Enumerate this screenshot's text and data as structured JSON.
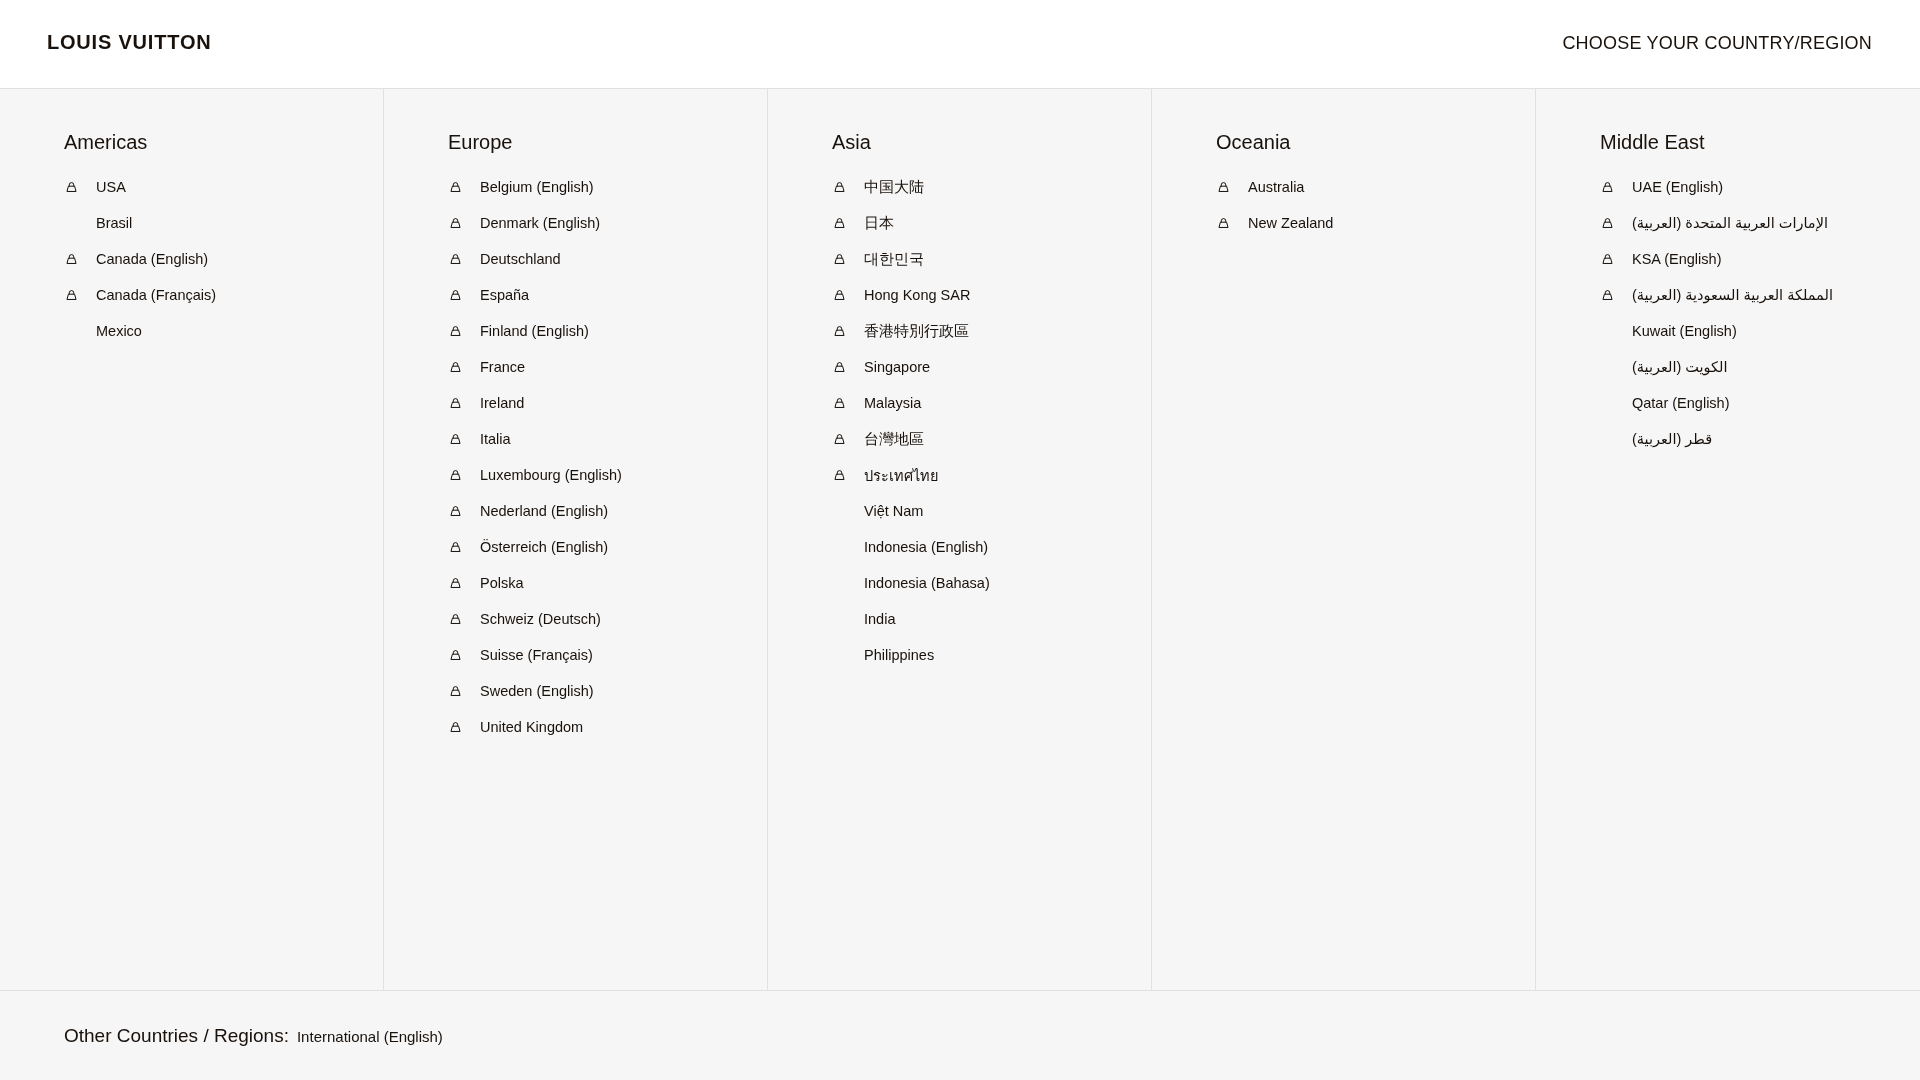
{
  "header": {
    "logo": "LOUIS VUITTON",
    "title": "CHOOSE YOUR COUNTRY/REGION"
  },
  "regions": [
    {
      "name": "Americas",
      "countries": [
        {
          "label": "USA",
          "shopping": true
        },
        {
          "label": "Brasil",
          "shopping": false
        },
        {
          "label": "Canada (English)",
          "shopping": true
        },
        {
          "label": "Canada (Français)",
          "shopping": true
        },
        {
          "label": "Mexico",
          "shopping": false
        }
      ]
    },
    {
      "name": "Europe",
      "countries": [
        {
          "label": "Belgium (English)",
          "shopping": true
        },
        {
          "label": "Denmark (English)",
          "shopping": true
        },
        {
          "label": "Deutschland",
          "shopping": true
        },
        {
          "label": "España",
          "shopping": true
        },
        {
          "label": "Finland (English)",
          "shopping": true
        },
        {
          "label": "France",
          "shopping": true
        },
        {
          "label": "Ireland",
          "shopping": true
        },
        {
          "label": "Italia",
          "shopping": true
        },
        {
          "label": "Luxembourg (English)",
          "shopping": true
        },
        {
          "label": "Nederland (English)",
          "shopping": true
        },
        {
          "label": "Österreich (English)",
          "shopping": true
        },
        {
          "label": "Polska",
          "shopping": true
        },
        {
          "label": "Schweiz (Deutsch)",
          "shopping": true
        },
        {
          "label": "Suisse (Français)",
          "shopping": true
        },
        {
          "label": "Sweden (English)",
          "shopping": true
        },
        {
          "label": "United Kingdom",
          "shopping": true
        }
      ]
    },
    {
      "name": "Asia",
      "countries": [
        {
          "label": "中国大陆",
          "shopping": true
        },
        {
          "label": "日本",
          "shopping": true
        },
        {
          "label": "대한민국",
          "shopping": true
        },
        {
          "label": "Hong Kong SAR",
          "shopping": true
        },
        {
          "label": "香港特別行政區",
          "shopping": true
        },
        {
          "label": "Singapore",
          "shopping": true
        },
        {
          "label": "Malaysia",
          "shopping": true
        },
        {
          "label": "台灣地區",
          "shopping": true
        },
        {
          "label": "ประเทศไทย",
          "shopping": true
        },
        {
          "label": "Việt Nam",
          "shopping": false
        },
        {
          "label": "Indonesia (English)",
          "shopping": false
        },
        {
          "label": "Indonesia (Bahasa)",
          "shopping": false
        },
        {
          "label": "India",
          "shopping": false
        },
        {
          "label": "Philippines",
          "shopping": false
        }
      ]
    },
    {
      "name": "Oceania",
      "countries": [
        {
          "label": "Australia",
          "shopping": true
        },
        {
          "label": "New Zealand",
          "shopping": true
        }
      ]
    },
    {
      "name": "Middle East",
      "countries": [
        {
          "label": "UAE (English)",
          "shopping": true
        },
        {
          "label": "الإمارات العربية المتحدة (العربية)",
          "shopping": true
        },
        {
          "label": "KSA (English)",
          "shopping": true
        },
        {
          "label": "المملكة العربية السعودية (العربية)",
          "shopping": true
        },
        {
          "label": "Kuwait (English)",
          "shopping": false
        },
        {
          "label": "الكويت (العربية)",
          "shopping": false
        },
        {
          "label": "Qatar (English)",
          "shopping": false
        },
        {
          "label": "قطر (العربية)",
          "shopping": false
        }
      ]
    }
  ],
  "footer": {
    "label": "Other Countries / Regions:",
    "link": "International (English)"
  }
}
